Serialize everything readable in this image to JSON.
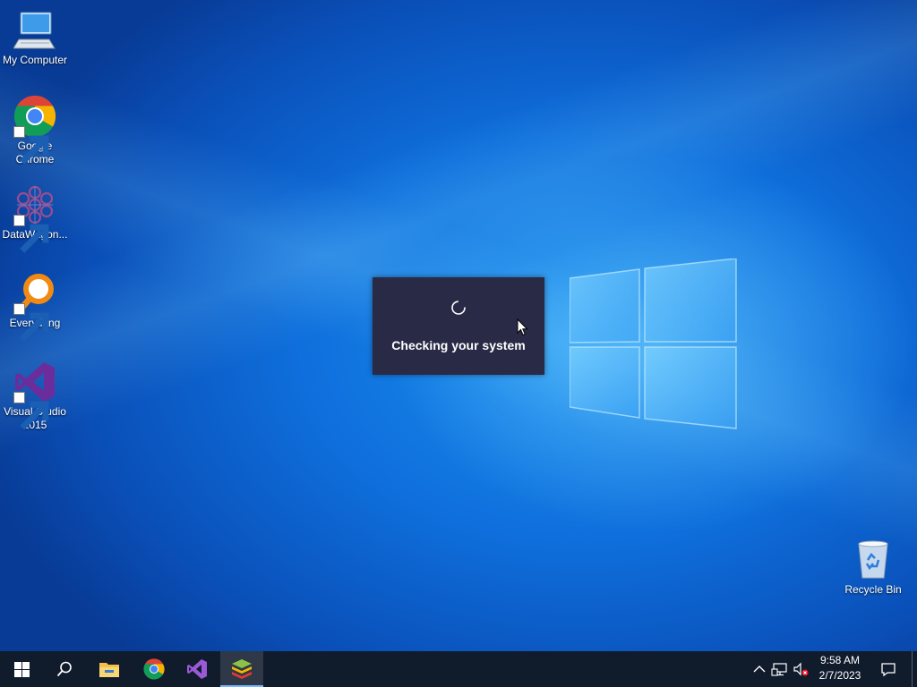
{
  "desktop": {
    "icons": [
      {
        "label": "My Computer",
        "icon": "computer-icon"
      },
      {
        "label": "Google Chrome",
        "icon": "chrome-icon"
      },
      {
        "label": "DataWagon...",
        "icon": "datawagon-icon"
      },
      {
        "label": "Everything",
        "icon": "everything-search-icon"
      },
      {
        "label": "Visual Studio 2015",
        "icon": "visual-studio-icon"
      },
      {
        "label": "Recycle Bin",
        "icon": "recycle-bin-icon"
      }
    ]
  },
  "dialog": {
    "message": "Checking your system",
    "icon": "loading-spinner-icon"
  },
  "taskbar": {
    "buttons": [
      "start-icon",
      "search-icon",
      "file-explorer-icon",
      "chrome-icon",
      "visual-studio-icon",
      "bluestacks-icon"
    ],
    "tray": {
      "icons": [
        "chevron-up-icon",
        "network-icon",
        "volume-muted-icon"
      ],
      "time": "9:58 AM",
      "date": "2/7/2023"
    }
  },
  "colors": {
    "desktop_blue": "#0f6fdc",
    "dialog_bg": "#282a46",
    "taskbar_bg": "#101b2c"
  }
}
